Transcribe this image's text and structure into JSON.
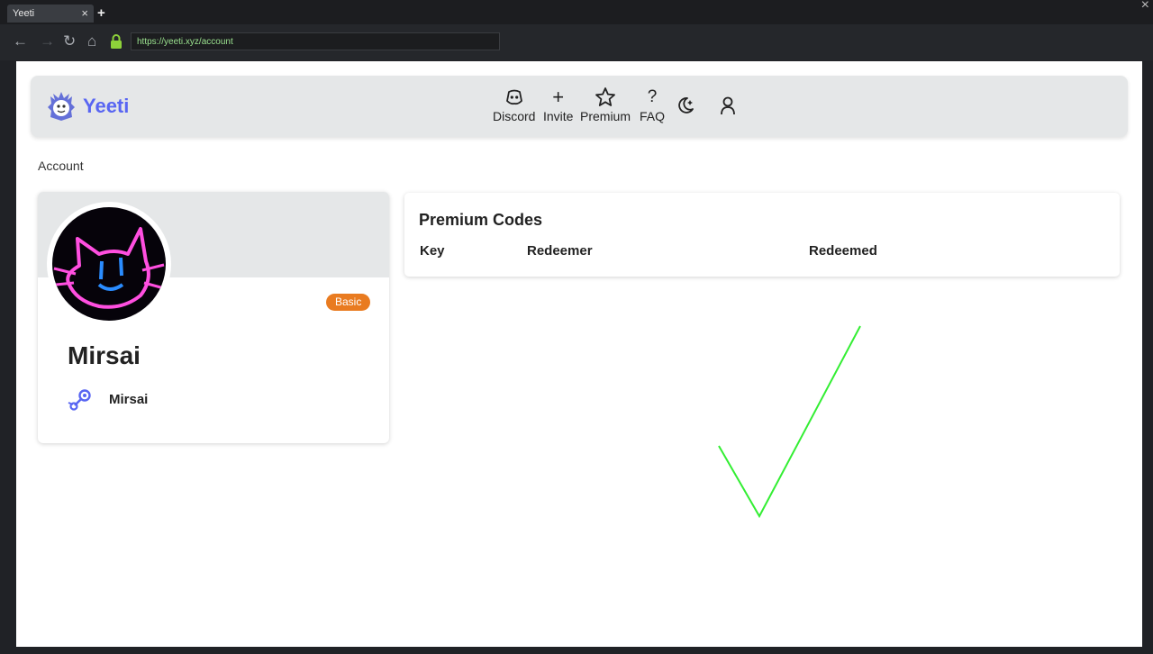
{
  "browser": {
    "tab_title": "Yeeti",
    "tab_close": "×",
    "new_tab": "+",
    "window_close": "×",
    "back": "←",
    "forward": "→",
    "reload": "↻",
    "home": "⌂",
    "url": "https://yeeti.xyz/account"
  },
  "header": {
    "brand": "Yeeti",
    "nav": [
      {
        "label": "Discord",
        "icon": "discord-icon"
      },
      {
        "label": "Invite",
        "icon": "plus-icon"
      },
      {
        "label": "Premium",
        "icon": "star-icon"
      },
      {
        "label": "FAQ",
        "icon": "question-icon"
      }
    ],
    "invite_symbol": "+",
    "faq_symbol": "?",
    "theme_toggle_icon": "moon-icon",
    "account_icon": "user-icon",
    "brand_color": "#5865f2"
  },
  "breadcrumb": "Account",
  "profile": {
    "name": "Mirsai",
    "badge": "Basic",
    "badge_color": "#e97b20",
    "steam_name": "Mirsai"
  },
  "premium_codes": {
    "title": "Premium Codes",
    "columns": [
      "Key",
      "Redeemer",
      "Redeemed"
    ],
    "rows": []
  },
  "annotation": {
    "icon": "checkmark-icon",
    "color": "#33ee33"
  }
}
